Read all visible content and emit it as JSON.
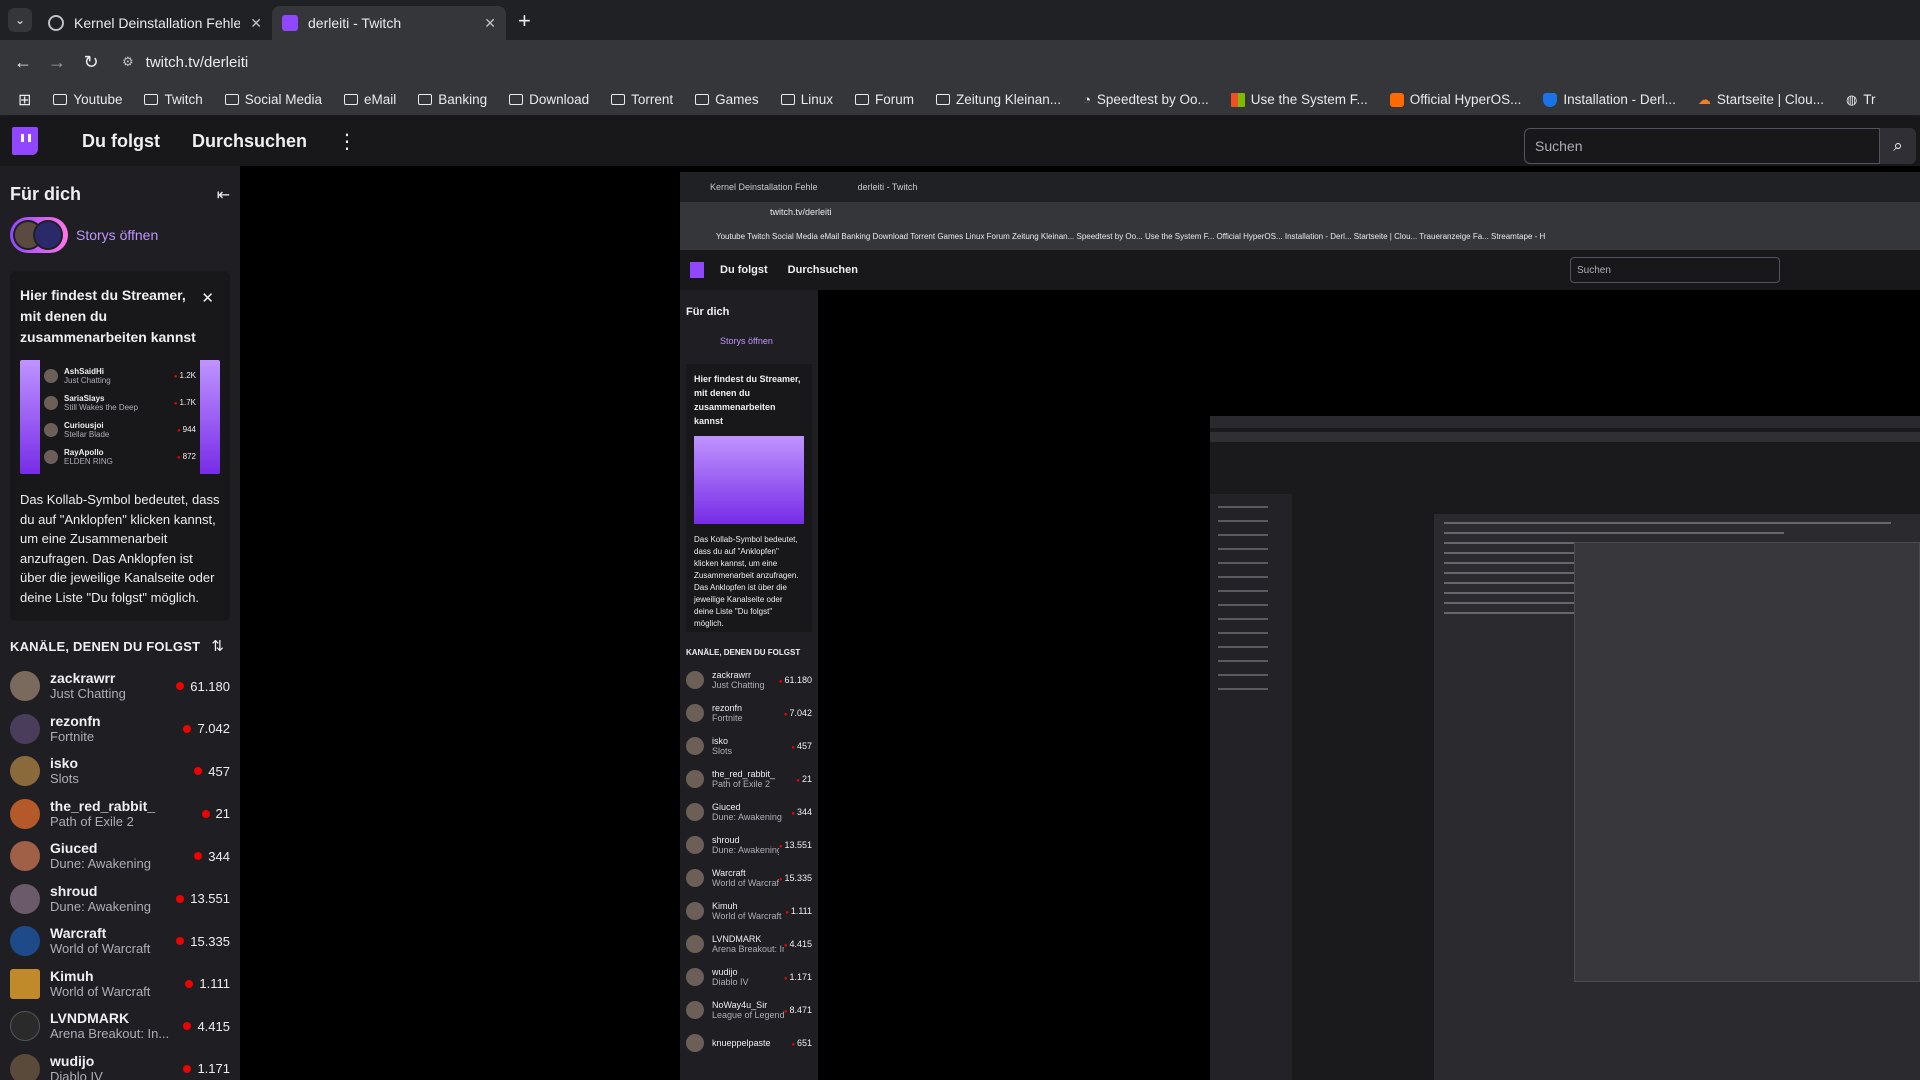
{
  "browser": {
    "tabs": [
      {
        "title": "Kernel Deinstallation Fehle",
        "active": false,
        "favicon": "kernel-favicon-icon"
      },
      {
        "title": "derleiti - Twitch",
        "active": true,
        "favicon": "twitch-favicon-icon"
      }
    ],
    "url": "twitch.tv/derleiti",
    "bookmarks": [
      {
        "label": "Youtube",
        "icon": "folder-icon"
      },
      {
        "label": "Twitch",
        "icon": "folder-icon"
      },
      {
        "label": "Social Media",
        "icon": "folder-icon"
      },
      {
        "label": "eMail",
        "icon": "folder-icon"
      },
      {
        "label": "Banking",
        "icon": "folder-icon"
      },
      {
        "label": "Download",
        "icon": "folder-icon"
      },
      {
        "label": "Torrent",
        "icon": "folder-icon"
      },
      {
        "label": "Games",
        "icon": "folder-icon"
      },
      {
        "label": "Linux",
        "icon": "folder-icon"
      },
      {
        "label": "Forum",
        "icon": "folder-icon"
      },
      {
        "label": "Zeitung Kleinan...",
        "icon": "folder-icon"
      },
      {
        "label": "Speedtest by Oo...",
        "icon": "speedtest-icon"
      },
      {
        "label": "Use the System F...",
        "icon": "microsoft-icon"
      },
      {
        "label": "Official HyperOS...",
        "icon": "hyperos-icon"
      },
      {
        "label": "Installation - Derl...",
        "icon": "shield-icon"
      },
      {
        "label": "Startseite | Clou...",
        "icon": "cloud-icon"
      },
      {
        "label": "Tr",
        "icon": "globe-icon"
      }
    ]
  },
  "twitch": {
    "nav": {
      "following": "Du folgst",
      "browse": "Durchsuchen",
      "search_placeholder": "Suchen"
    },
    "sidebar": {
      "for_you": "Für dich",
      "stories": "Storys öffnen",
      "collab_card": {
        "title": "Hier findest du Streamer, mit denen du zusammenarbeiten kannst",
        "preview": [
          {
            "name": "AshSaidHi",
            "game": "Just Chatting",
            "viewers": "1.2K"
          },
          {
            "name": "SariaSlays",
            "game": "Still Wakes the Deep",
            "viewers": "1.7K"
          },
          {
            "name": "Curiousjoi",
            "game": "Stellar Blade",
            "viewers": "944"
          },
          {
            "name": "RayApollo",
            "game": "ELDEN RING",
            "viewers": "872"
          }
        ],
        "text": "Das Kollab-Symbol bedeutet, dass du auf \"Anklopfen\" klicken kannst, um eine Zusammenarbeit anzufragen. Das Anklopfen ist über die jeweilige Kanalseite oder deine Liste \"Du folgst\" möglich."
      },
      "followed_title": "KANÄLE, DENEN DU FOLGST",
      "channels": [
        {
          "name": "zackrawrr",
          "game": "Just Chatting",
          "viewers": "61.180",
          "color": "#7a6a5e"
        },
        {
          "name": "rezonfn",
          "game": "Fortnite",
          "viewers": "7.042",
          "color": "#4a3d5c"
        },
        {
          "name": "isko",
          "game": "Slots",
          "viewers": "457",
          "color": "#8a6a3a"
        },
        {
          "name": "the_red_rabbit_",
          "game": "Path of Exile 2",
          "viewers": "21",
          "color": "#b45a2a"
        },
        {
          "name": "Giuced",
          "game": "Dune: Awakening",
          "viewers": "344",
          "color": "#a06048"
        },
        {
          "name": "shroud",
          "game": "Dune: Awakening",
          "viewers": "13.551",
          "color": "#6a5a6a"
        },
        {
          "name": "Warcraft",
          "game": "World of Warcraft",
          "viewers": "15.335",
          "color": "#1f4a8a"
        },
        {
          "name": "Kimuh",
          "game": "World of Warcraft",
          "viewers": "1.111",
          "color": "#c08a2a"
        },
        {
          "name": "LVNDMARK",
          "game": "Arena Breakout: In...",
          "viewers": "4.415",
          "color": "#2a2a2a"
        },
        {
          "name": "wudijo",
          "game": "Diablo IV",
          "viewers": "1.171",
          "color": "#5a4a3a"
        }
      ]
    }
  },
  "capture": {
    "tabs": [
      "Kernel Deinstallation Fehle",
      "derleiti - Twitch"
    ],
    "url": "twitch.tv/derleiti",
    "bookmarks_line": "Youtube   Twitch   Social Media   eMail   Banking   Download   Torrent   Games   Linux   Forum   Zeitung Kleinan...   Speedtest by Oo...   Use the System F...   Official HyperOS...   Installation - Derl...   Startseite | Clou...   Traueranzeige Fa...   Streamtape - H",
    "nav": {
      "following": "Du folgst",
      "browse": "Durchsuchen",
      "search": "Suchen"
    },
    "sidebar": {
      "for_you": "Für dich",
      "stories": "Storys öffnen",
      "card_title": "Hier findest du Streamer, mit denen du zusammenarbeiten kannst",
      "card_text": "Das Kollab-Symbol bedeutet, dass du auf \"Anklopfen\" klicken kannst, um eine Zusammenarbeit anzufragen. Das Anklopfen ist über die jeweilige Kanalseite oder deine Liste \"Du folgst\" möglich.",
      "followed_title": "KANÄLE, DENEN DU FOLGST",
      "channels": [
        {
          "name": "zackrawrr",
          "game": "Just Chatting",
          "viewers": "61.180"
        },
        {
          "name": "rezonfn",
          "game": "Fortnite",
          "viewers": "7.042"
        },
        {
          "name": "isko",
          "game": "Slots",
          "viewers": "457"
        },
        {
          "name": "the_red_rabbit_",
          "game": "Path of Exile 2",
          "viewers": "21"
        },
        {
          "name": "Giuced",
          "game": "Dune: Awakening",
          "viewers": "344"
        },
        {
          "name": "shroud",
          "game": "Dune: Awakening",
          "viewers": "13.551"
        },
        {
          "name": "Warcraft",
          "game": "World of Warcraft",
          "viewers": "15.335"
        },
        {
          "name": "Kimuh",
          "game": "World of Warcraft",
          "viewers": "1.111"
        },
        {
          "name": "LVNDMARK",
          "game": "Arena Breakout: In...",
          "viewers": "4.415"
        },
        {
          "name": "wudijo",
          "game": "Diablo IV",
          "viewers": "1.171"
        },
        {
          "name": "NoWay4u_Sir",
          "game": "League of Legends",
          "viewers": "8.471"
        },
        {
          "name": "knueppelpaste",
          "game": "",
          "viewers": "651"
        }
      ]
    }
  }
}
